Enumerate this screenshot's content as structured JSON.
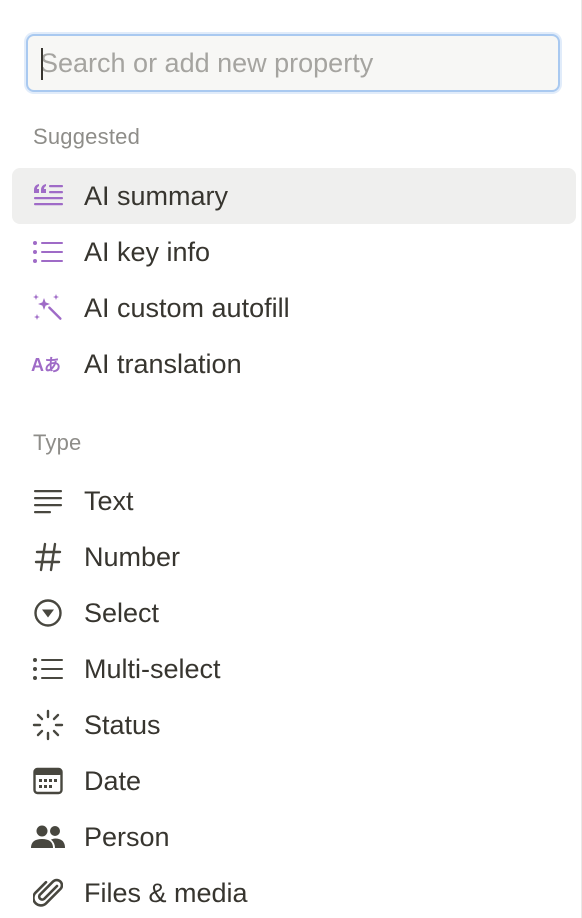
{
  "search": {
    "placeholder": "Search or add new property",
    "value": ""
  },
  "suggested": {
    "heading": "Suggested",
    "items": [
      {
        "label": "AI summary",
        "icon": "ai-summary-icon"
      },
      {
        "label": "AI key info",
        "icon": "list-icon"
      },
      {
        "label": "AI custom autofill",
        "icon": "sparkles-icon"
      },
      {
        "label": "AI translation",
        "icon": "translate-icon"
      }
    ]
  },
  "type": {
    "heading": "Type",
    "items": [
      {
        "label": "Text",
        "icon": "text-lines-icon"
      },
      {
        "label": "Number",
        "icon": "hash-icon"
      },
      {
        "label": "Select",
        "icon": "select-circle-icon"
      },
      {
        "label": "Multi-select",
        "icon": "bullet-list-icon"
      },
      {
        "label": "Status",
        "icon": "status-spinner-icon"
      },
      {
        "label": "Date",
        "icon": "calendar-icon"
      },
      {
        "label": "Person",
        "icon": "people-icon"
      },
      {
        "label": "Files & media",
        "icon": "paperclip-icon"
      }
    ]
  },
  "colors": {
    "ai_purple": "#9f6bc7",
    "icon_gray": "#48473f",
    "hover_bg": "#efefee",
    "focus_ring": "#a9c9f0"
  }
}
